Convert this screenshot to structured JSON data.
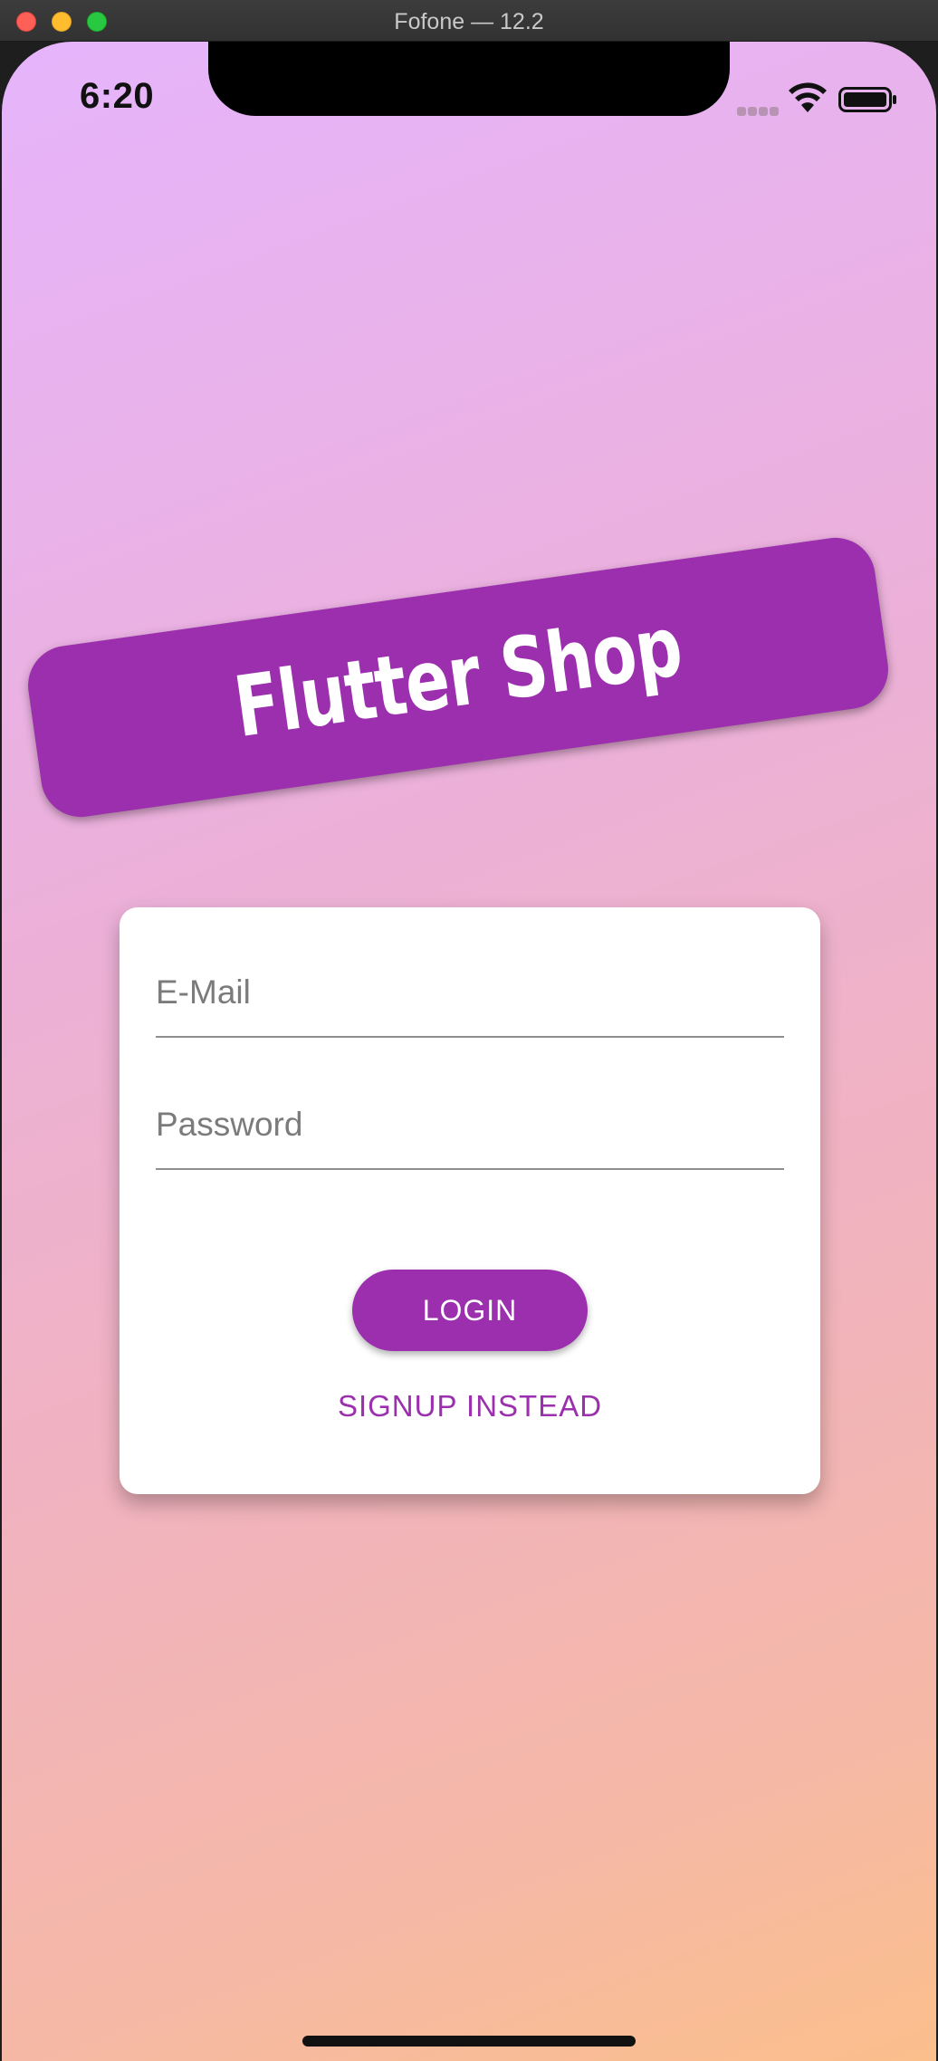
{
  "window": {
    "title": "Fofone — 12.2"
  },
  "status_bar": {
    "time": "6:20",
    "signal_icon": "cellular-signal-icon",
    "wifi_icon": "wifi-icon",
    "battery_icon": "battery-icon"
  },
  "banner": {
    "title": "Flutter Shop",
    "color": "#9b2fae"
  },
  "auth_form": {
    "email": {
      "value": "",
      "placeholder": "E-Mail"
    },
    "password": {
      "value": "",
      "placeholder": "Password"
    },
    "login_label": "LOGIN",
    "signup_label": "SIGNUP INSTEAD"
  },
  "colors": {
    "primary": "#9b2fae",
    "gradient_top": "#e6b4fb",
    "gradient_bottom": "#fbbf8c"
  }
}
